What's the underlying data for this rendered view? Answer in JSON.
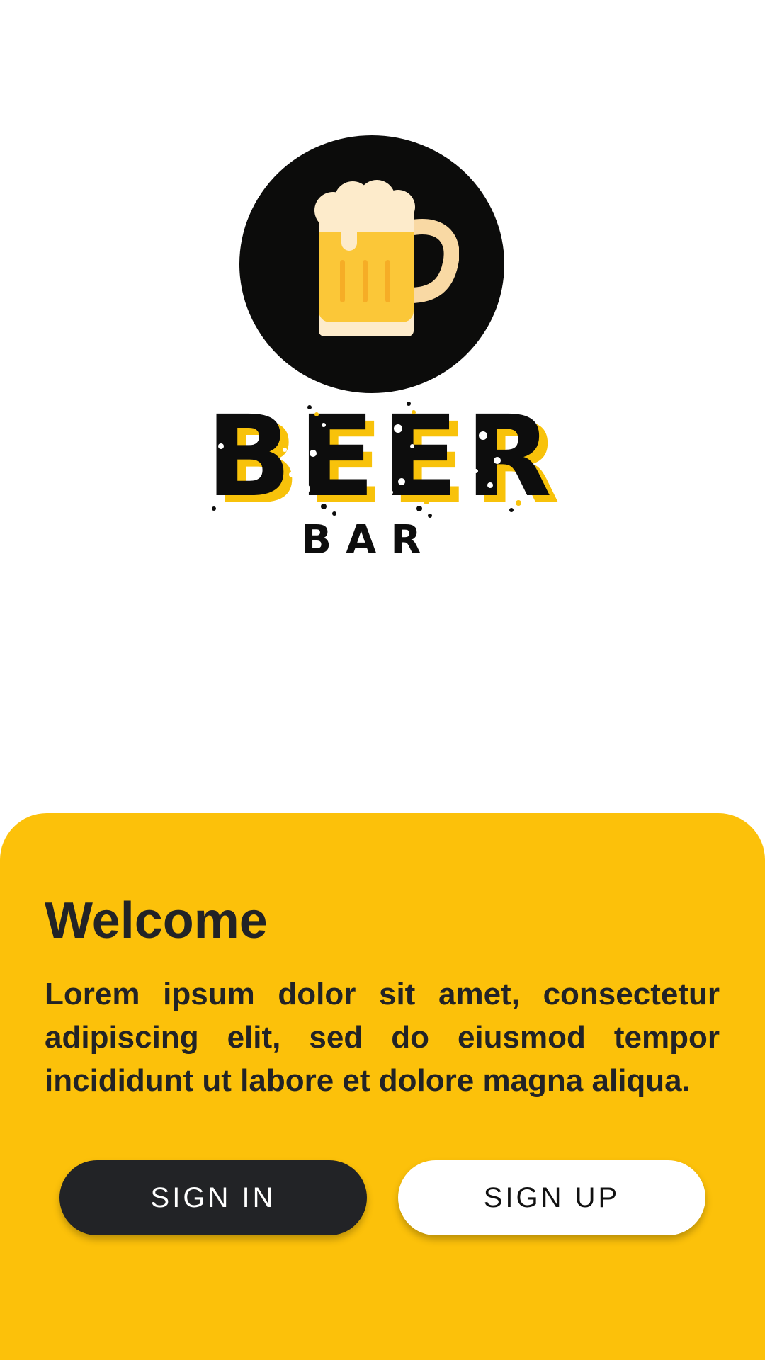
{
  "logo": {
    "title": "BEER",
    "subtitle": "BAR",
    "icon": "beer-mug-icon"
  },
  "welcome": {
    "title": "Welcome",
    "body": "Lorem ipsum dolor sit amet, consectetur adipiscing elit, sed do eiusmod tempor incididunt ut labore et dolore magna aliqua."
  },
  "buttons": {
    "sign_in": "SIGN IN",
    "sign_up": "SIGN UP"
  },
  "colors": {
    "accent": "#fcc10a",
    "dark": "#222326",
    "logo_circle": "#0c0c0b",
    "mug_body": "#fbc738",
    "foam": "#fdebcb"
  }
}
